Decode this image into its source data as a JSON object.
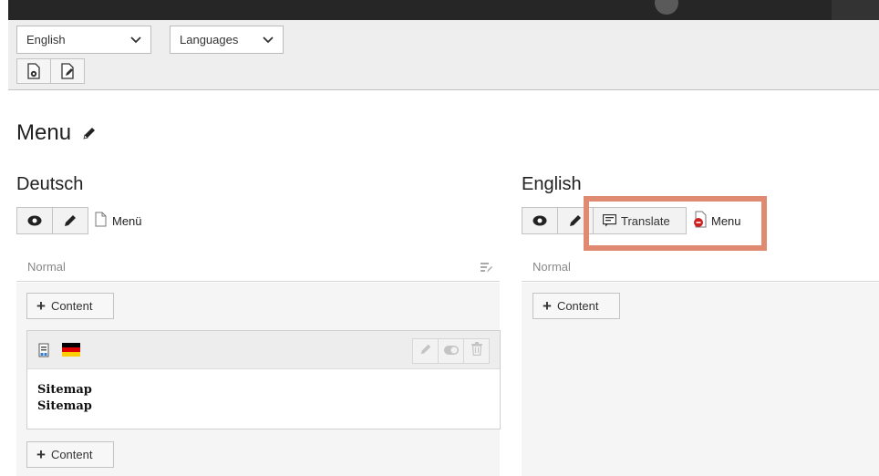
{
  "toolbar": {
    "language_select": "English",
    "languages_select": "Languages",
    "preview_icon": "view-page-icon",
    "edit_page_icon": "edit-page-properties-icon"
  },
  "page": {
    "title": "Menu"
  },
  "columns": {
    "left": {
      "language": "Deutsch",
      "page_label": "Menü",
      "column_name": "Normal",
      "add_content_label": "Content",
      "element": {
        "line1": "Sitemap",
        "line2": "Sitemap"
      },
      "add_content_label_bottom": "Content"
    },
    "right": {
      "language": "English",
      "translate_label": "Translate",
      "page_label": "Menu",
      "column_name": "Normal",
      "add_content_label": "Content"
    }
  },
  "colors": {
    "highlight": "#e08a72",
    "docheader": "#eeeeee",
    "flag_black": "#000000",
    "flag_red": "#dd0000",
    "flag_gold": "#ffce00"
  }
}
